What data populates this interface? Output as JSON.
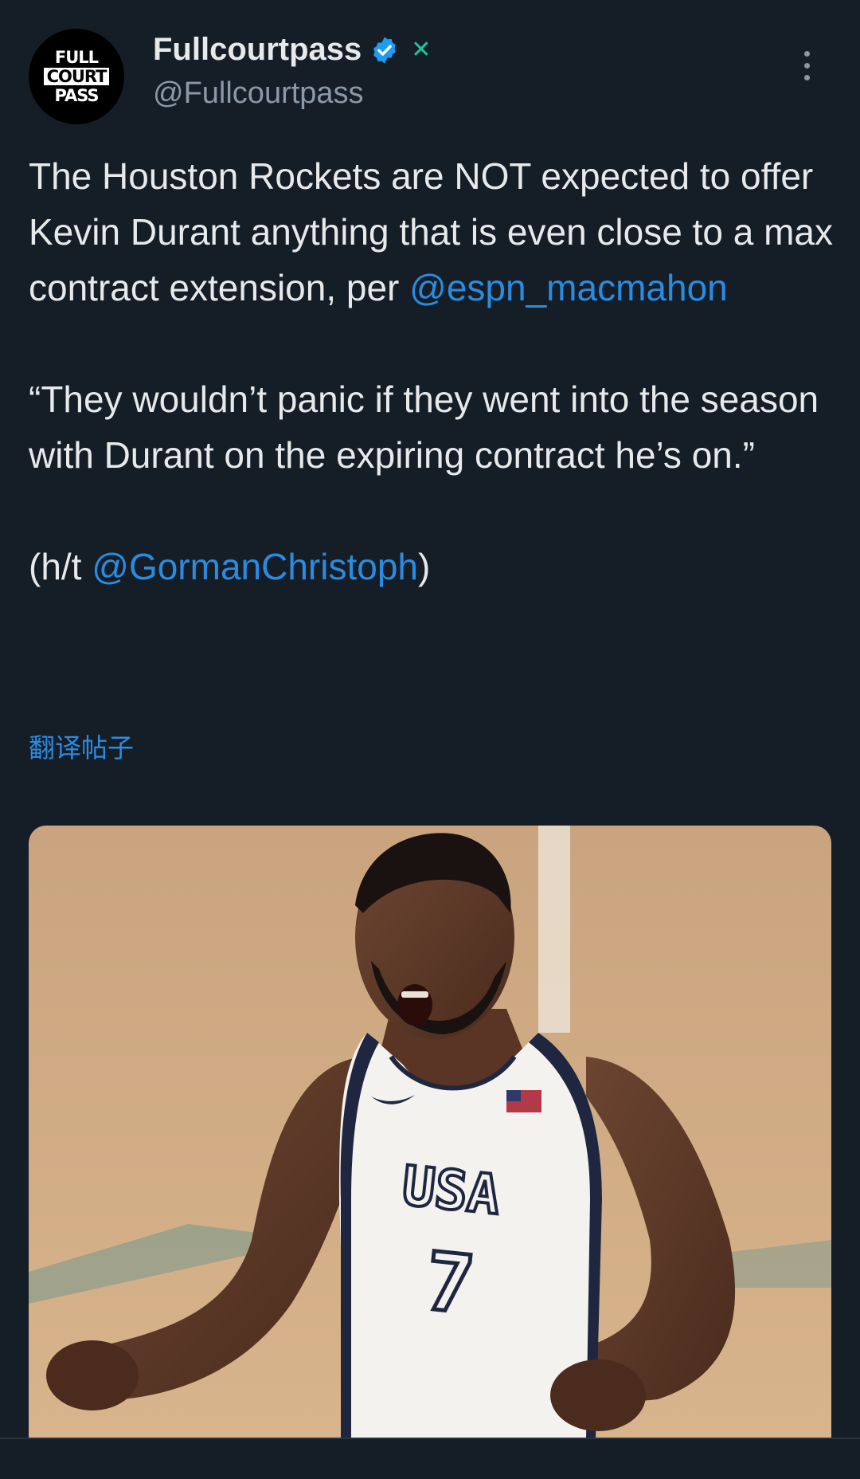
{
  "author": {
    "avatar_lines": [
      "FULL",
      "COURT",
      "PASS"
    ],
    "display_name": "Fullcourtpass",
    "handle": "@Fullcourtpass",
    "verified_icon": "verified-badge-icon",
    "affiliation_icon": "x-logo-icon",
    "affiliation_glyph": "✕"
  },
  "tweet": {
    "line1": "The Houston Rockets are NOT expected to offer Kevin Durant anything that is even close to a max contract extension, per ",
    "mention1": "@espn_macmahon",
    "quote": "“They wouldn’t panic if they went into the season with Durant on the expiring contract he’s on.”",
    "ht_prefix": "(h/t ",
    "mention2": "@GormanChristoph",
    "ht_suffix": ")"
  },
  "translate_label": "翻译帖子",
  "media": {
    "jersey_text": "USA",
    "jersey_number": "7"
  },
  "colors": {
    "background": "#151d27",
    "link": "#2a8ce0",
    "verified": "#1d9bf0",
    "x_badge": "#1fc6a4",
    "secondary_text": "#8b98a5"
  }
}
